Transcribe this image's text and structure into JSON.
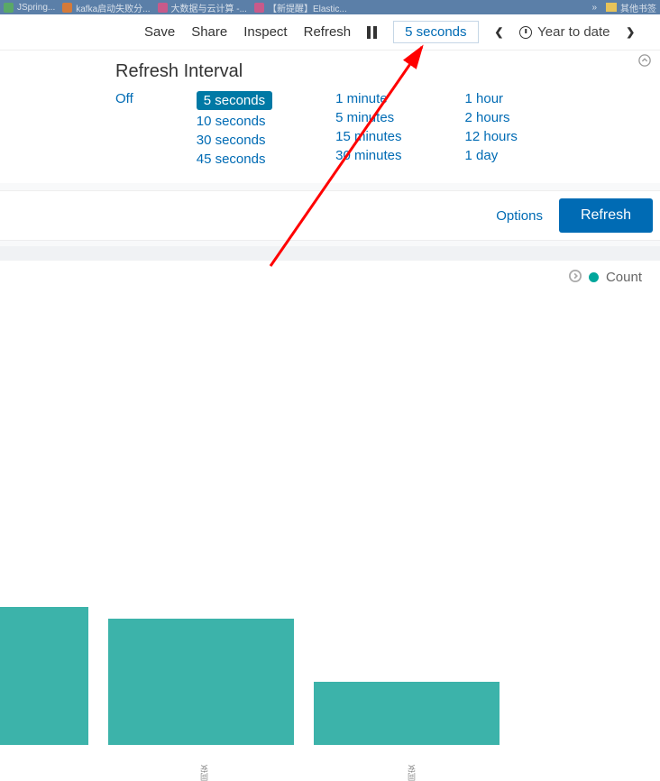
{
  "browser": {
    "tabs": [
      {
        "label": "JSpring..."
      },
      {
        "label": "kafka启动失败分..."
      },
      {
        "label": "大数据与云计算 -..."
      },
      {
        "label": "【新提醒】Elastic..."
      }
    ],
    "overflow": "»",
    "bookmark_folder": "其他书签"
  },
  "topbar": {
    "save": "Save",
    "share": "Share",
    "inspect": "Inspect",
    "refresh": "Refresh",
    "interval_button": "5 seconds",
    "year_to_date": "Year to date"
  },
  "interval": {
    "title": "Refresh Interval",
    "col1": [
      "Off"
    ],
    "col2": [
      "5 seconds",
      "10 seconds",
      "30 seconds",
      "45 seconds"
    ],
    "col3": [
      "1 minute",
      "5 minutes",
      "15 minutes",
      "30 minutes"
    ],
    "col4": [
      "1 hour",
      "2 hours",
      "12 hours",
      "1 day"
    ],
    "selected": "5 seconds"
  },
  "options_bar": {
    "options": "Options",
    "refresh_btn": "Refresh"
  },
  "legend": {
    "count": "Count"
  },
  "xlabels": {
    "l1": "同安",
    "l2": "同安"
  },
  "chart_data": {
    "type": "bar",
    "title": "",
    "xlabel": "",
    "ylabel": "",
    "categories": [
      "",
      "同安",
      "同安"
    ],
    "series": [
      {
        "name": "Count",
        "values": [
          175,
          160,
          80
        ]
      }
    ],
    "ylim": [
      0,
      200
    ],
    "colors": {
      "Count": "#3cb3aa"
    },
    "legend_position": "top-right"
  }
}
